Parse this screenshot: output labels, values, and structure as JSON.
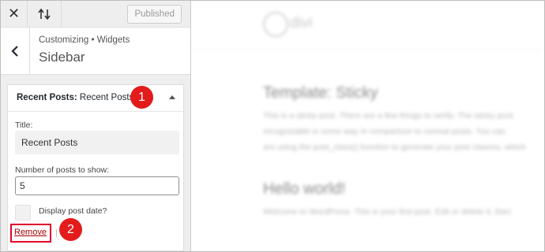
{
  "topbar": {
    "close_icon": "close-icon",
    "reorder_icon": "reorder-icon",
    "published_label": "Published"
  },
  "section": {
    "breadcrumb": "Customizing • Widgets",
    "title": "Sidebar",
    "back_icon": "chevron-left-icon"
  },
  "widget": {
    "name_bold": "Recent Posts",
    "name_rest": "Recent Posts",
    "title_label": "Title:",
    "title_value": "Recent Posts",
    "count_label": "Number of posts to show:",
    "count_value": "5",
    "date_label": "Display post date?",
    "remove_label": "Remove",
    "pipe": "|"
  },
  "annotations": {
    "step1": "1",
    "step2": "2",
    "highlight_color": "#e0002a"
  },
  "preview": {
    "logo_text": "divi",
    "post1_title": "Template: Sticky",
    "post1_lines": [
      "This is a sticky post. There are a few things to verify: The sticky post",
      "recognizable in some way in comparison to normal posts. You can",
      "are using the post_class() function to generate your post classes, which"
    ],
    "post2_title": "Hello world!",
    "post2_line": "Welcome to WordPress. This is your first post. Edit or delete it, then"
  }
}
